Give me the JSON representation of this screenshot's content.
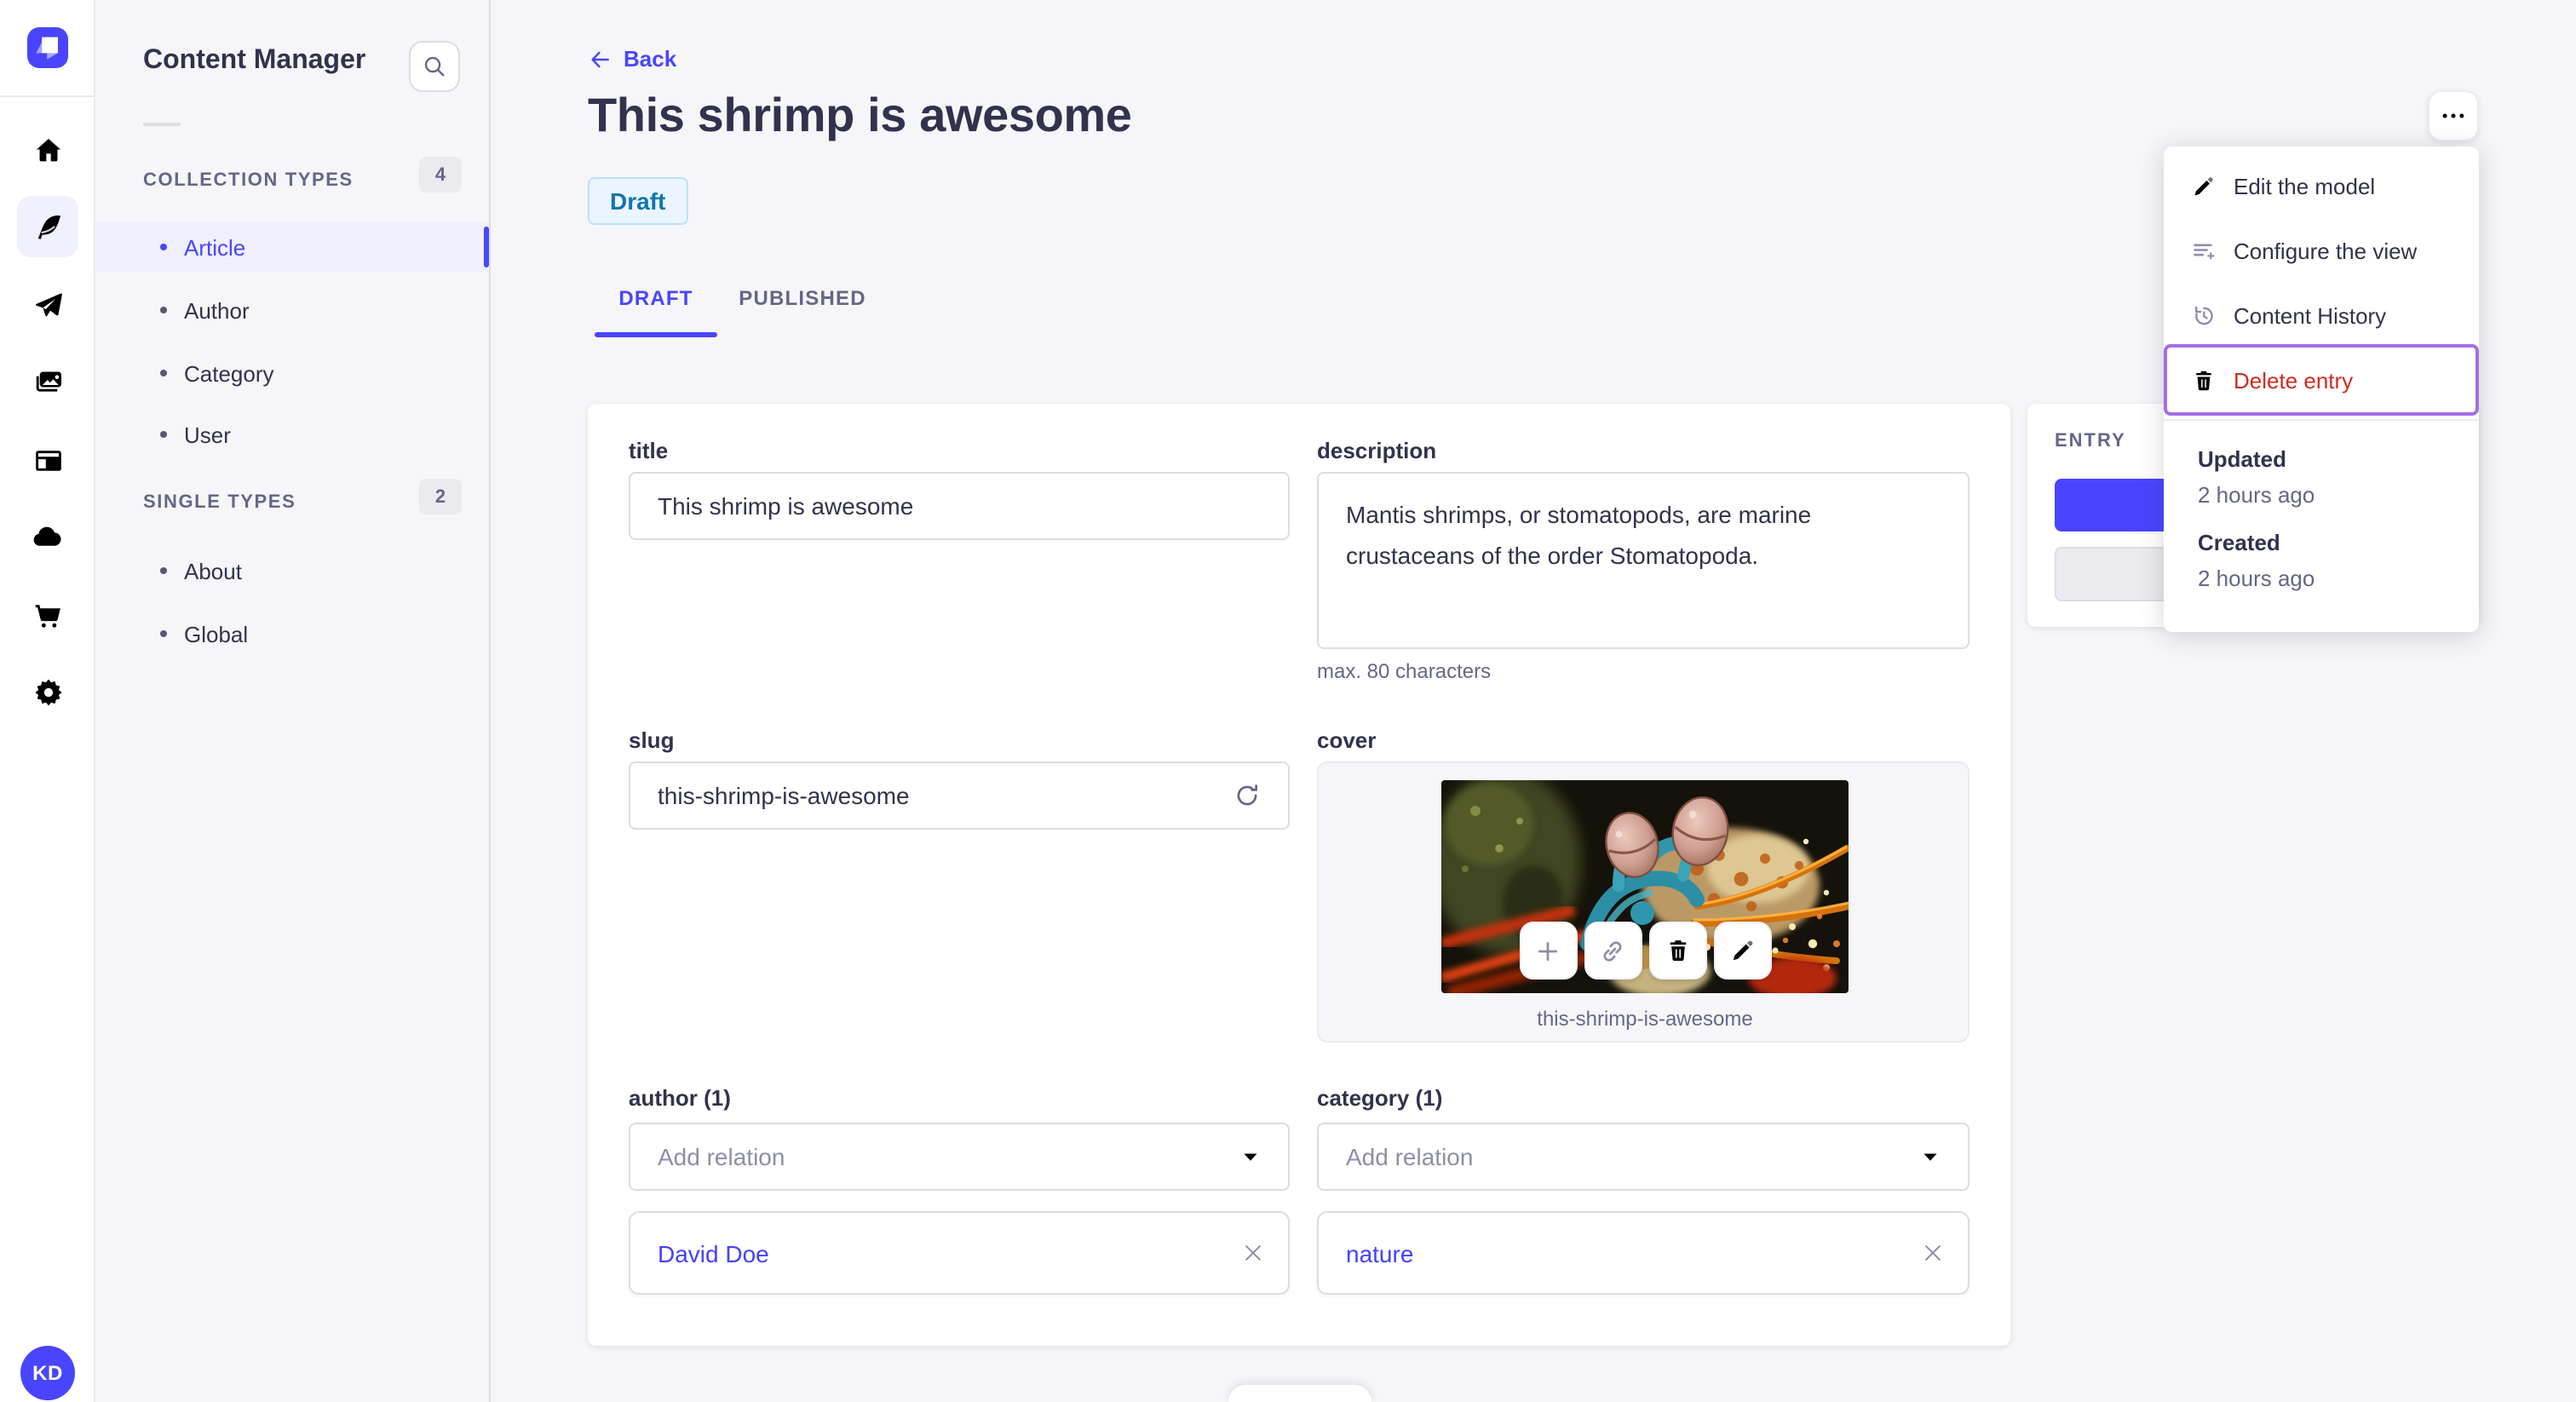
{
  "rail": {
    "icons": [
      {
        "name": "home"
      },
      {
        "name": "content-manager-feather",
        "active": true
      },
      {
        "name": "paper-plane"
      },
      {
        "name": "media-library"
      },
      {
        "name": "layout"
      },
      {
        "name": "cloud"
      },
      {
        "name": "cart"
      },
      {
        "name": "gear"
      }
    ],
    "avatar_initials": "KD"
  },
  "subnav": {
    "title": "Content Manager",
    "sections": [
      {
        "label": "COLLECTION TYPES",
        "count": "4",
        "items": [
          {
            "label": "Article",
            "active": true
          },
          {
            "label": "Author"
          },
          {
            "label": "Category"
          },
          {
            "label": "User"
          }
        ]
      },
      {
        "label": "SINGLE TYPES",
        "count": "2",
        "items": [
          {
            "label": "About"
          },
          {
            "label": "Global"
          }
        ]
      }
    ]
  },
  "header": {
    "back_label": "Back",
    "title": "This shrimp is awesome",
    "status": "Draft",
    "tabs": [
      {
        "label": "DRAFT",
        "active": true
      },
      {
        "label": "PUBLISHED",
        "active": false
      }
    ]
  },
  "form": {
    "title": {
      "label": "title",
      "value": "This shrimp is awesome"
    },
    "description": {
      "label": "description",
      "value": "Mantis shrimps, or stomatopods, are marine crustaceans of the order Stomatopoda.",
      "hint": "max. 80 characters"
    },
    "slug": {
      "label": "slug",
      "value": "this-shrimp-is-awesome"
    },
    "cover": {
      "label": "cover",
      "filename": "this-shrimp-is-awesome"
    },
    "author": {
      "label": "author (1)",
      "placeholder": "Add relation",
      "relations": [
        {
          "name": "David Doe"
        }
      ]
    },
    "category": {
      "label": "category (1)",
      "placeholder": "Add relation",
      "relations": [
        {
          "name": "nature"
        }
      ]
    }
  },
  "entry_panel": {
    "label": "ENTRY"
  },
  "menu": {
    "items": [
      {
        "label": "Edit the model",
        "icon": "pencil"
      },
      {
        "label": "Configure the view",
        "icon": "list-plus"
      },
      {
        "label": "Content History",
        "icon": "history-clock"
      },
      {
        "label": "Delete entry",
        "icon": "trash",
        "danger": true,
        "highlighted": true
      }
    ],
    "meta": [
      {
        "label": "Updated",
        "value": "2 hours ago"
      },
      {
        "label": "Created",
        "value": "2 hours ago"
      }
    ]
  },
  "colors": {
    "accent": "#4945ff",
    "accent_bg": "#f0f0ff",
    "danger": "#d02b20",
    "highlight_outline": "#a36ee6",
    "draft_bg": "#eaf5ff",
    "draft_border": "#b8e1ff",
    "draft_text": "#1075af",
    "page_bg": "#f6f6f9"
  }
}
